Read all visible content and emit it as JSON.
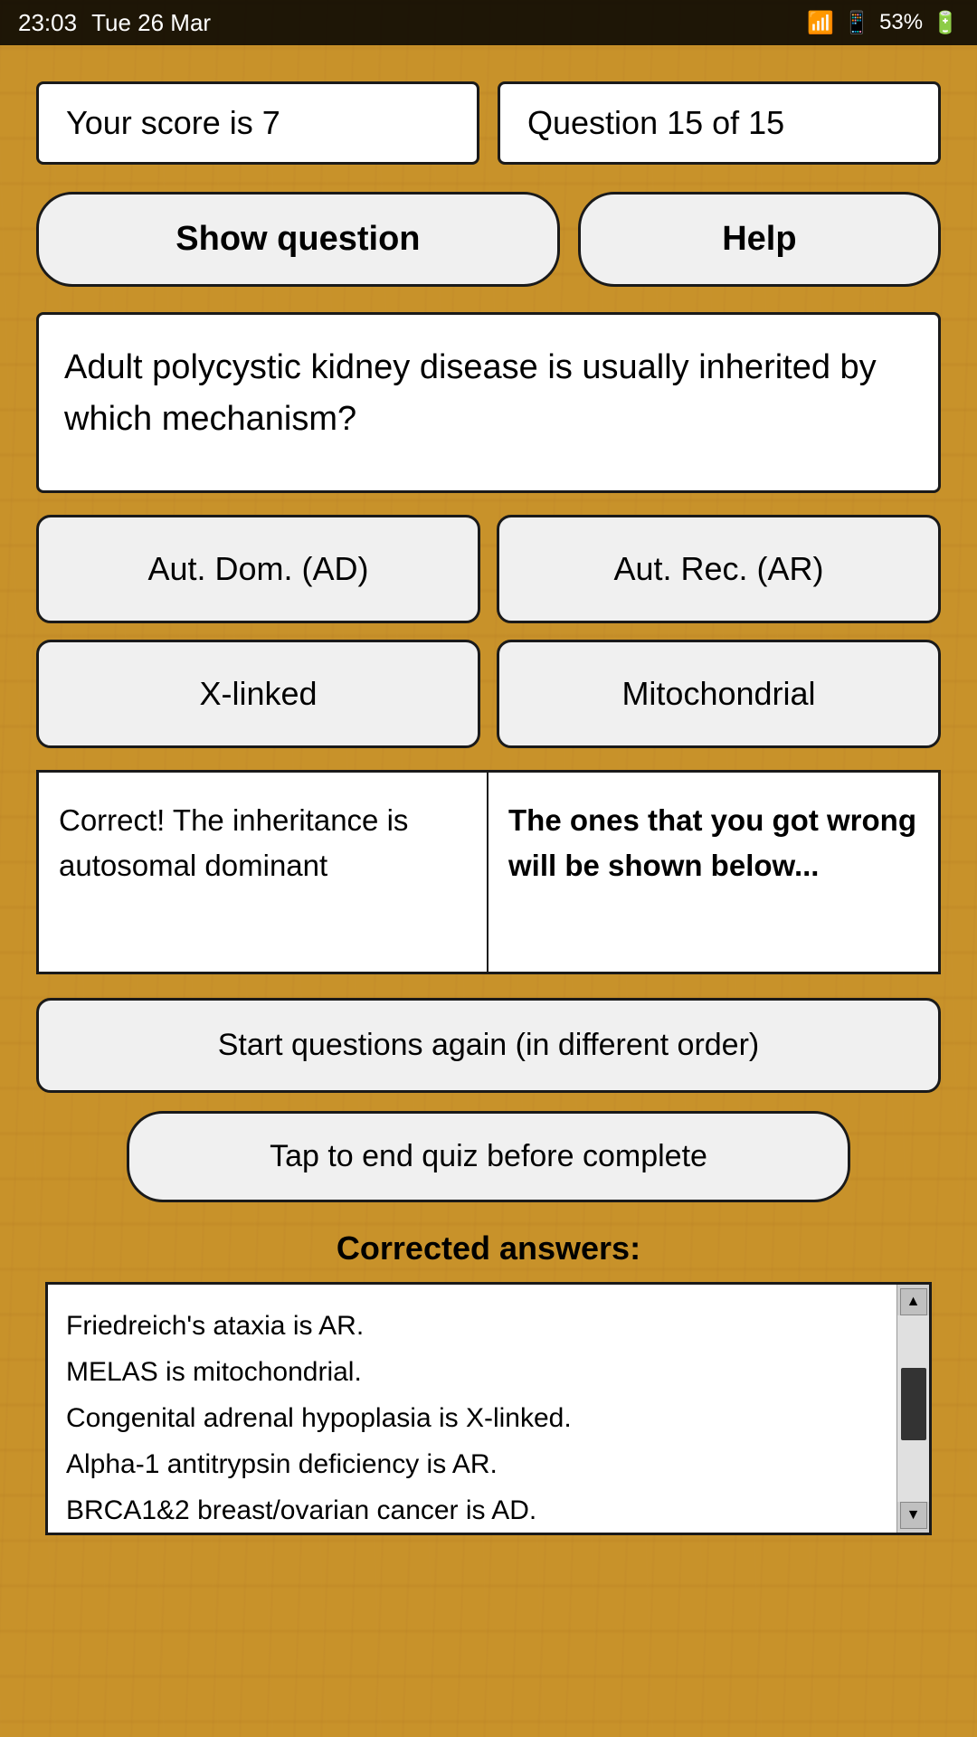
{
  "statusBar": {
    "time": "23:03",
    "date": "Tue 26 Mar",
    "battery": "53%"
  },
  "scoreBox": {
    "label": "Your score is 7"
  },
  "questionBox": {
    "label": "Question 15 of 15"
  },
  "buttons": {
    "showQuestion": "Show question",
    "help": "Help"
  },
  "questionText": "Adult polycystic kidney disease  is usually  inherited  by  which mechanism?",
  "options": [
    {
      "id": "ad",
      "label": "Aut. Dom. (AD)"
    },
    {
      "id": "ar",
      "label": "Aut. Rec. (AR)"
    },
    {
      "id": "xlinked",
      "label": "X-linked"
    },
    {
      "id": "mito",
      "label": "Mitochondrial"
    }
  ],
  "resultLeft": "Correct! The inheritance is autosomal dominant",
  "resultRight": "The ones that you got wrong will be shown below...",
  "restartButton": "Start questions again (in different order)",
  "endButton": "Tap to end quiz before complete",
  "correctedLabel": "Corrected answers:",
  "correctedAnswers": [
    "Friedreich's ataxia  is AR.",
    "MELAS  is mitochondrial.",
    "Congenital adrenal hypoplasia  is X-linked.",
    "Alpha-1 antitrypsin deficiency  is AR.",
    "BRCA1&2 breast/ovarian cancer  is AD."
  ]
}
